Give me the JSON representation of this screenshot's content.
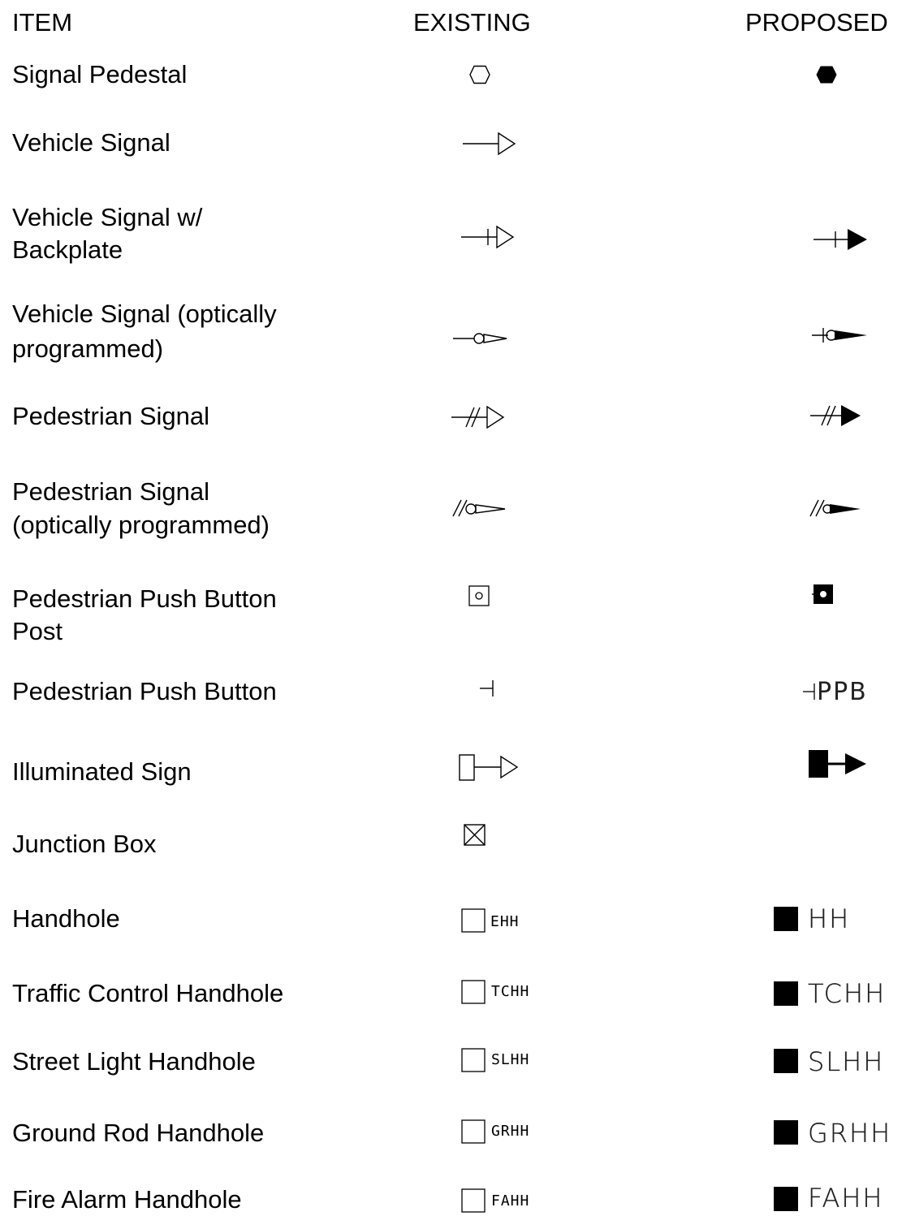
{
  "header": {
    "item": "ITEM",
    "existing": "EXISTING",
    "proposed": "PROPOSED"
  },
  "rows": [
    {
      "label_lines": [
        "Signal Pedestal"
      ],
      "existing_symbol": "hexagon-outline-icon",
      "proposed_symbol": "hexagon-filled-icon"
    },
    {
      "label_lines": [
        "Vehicle Signal"
      ],
      "existing_symbol": "vehicle-signal-outline-icon",
      "proposed_symbol": ""
    },
    {
      "label_lines": [
        "Vehicle Signal w/",
        "Backplate"
      ],
      "existing_symbol": "vehicle-signal-backplate-outline-icon",
      "proposed_symbol": "vehicle-signal-backplate-filled-icon"
    },
    {
      "label_lines": [
        "Vehicle Signal (optically",
        "programmed)"
      ],
      "existing_symbol": "optically-programmed-outline-icon",
      "proposed_symbol": "optically-programmed-filled-icon"
    },
    {
      "label_lines": [
        "Pedestrian Signal"
      ],
      "existing_symbol": "pedestrian-signal-outline-icon",
      "proposed_symbol": "pedestrian-signal-filled-icon"
    },
    {
      "label_lines": [
        "Pedestrian  Signal",
        "(optically  programmed)"
      ],
      "existing_symbol": "pedestrian-optical-outline-icon",
      "proposed_symbol": "pedestrian-optical-filled-icon"
    },
    {
      "label_lines": [
        "Pedestrian Push  Button",
        "Post"
      ],
      "existing_symbol": "push-button-post-outline-icon",
      "proposed_symbol": "push-button-post-filled-icon"
    },
    {
      "label_lines": [
        "Pedestrian  Push Button"
      ],
      "existing_symbol": "push-button-icon",
      "proposed_symbol": "push-button-icon",
      "proposed_tag": "PPB"
    },
    {
      "label_lines": [
        "Illuminated Sign"
      ],
      "existing_symbol": "illuminated-sign-outline-icon",
      "proposed_symbol": "illuminated-sign-filled-icon"
    },
    {
      "label_lines": [
        "Junction Box"
      ],
      "existing_symbol": "junction-box-icon",
      "proposed_symbol": ""
    },
    {
      "label_lines": [
        "Handhole"
      ],
      "existing_symbol": "square-outline-icon",
      "existing_tag": "EHH",
      "proposed_symbol": "square-filled-icon",
      "proposed_tag": "HH"
    },
    {
      "label_lines": [
        "Traffic Control  Handhole"
      ],
      "existing_symbol": "square-outline-icon",
      "existing_tag": "TCHH",
      "proposed_symbol": "square-filled-icon",
      "proposed_tag": "TCHH"
    },
    {
      "label_lines": [
        "Street Light  Handhole"
      ],
      "existing_symbol": "square-outline-icon",
      "existing_tag": "SLHH",
      "proposed_symbol": "square-filled-icon",
      "proposed_tag": "SLHH"
    },
    {
      "label_lines": [
        "Ground Rod  Handhole"
      ],
      "existing_symbol": "square-outline-icon",
      "existing_tag": "GRHH",
      "proposed_symbol": "square-filled-icon",
      "proposed_tag": "GRHH"
    },
    {
      "label_lines": [
        "Fire Alarm  Handhole"
      ],
      "existing_symbol": "square-outline-icon",
      "existing_tag": "FAHH",
      "proposed_symbol": "square-filled-icon",
      "proposed_tag": "FAHH"
    }
  ]
}
